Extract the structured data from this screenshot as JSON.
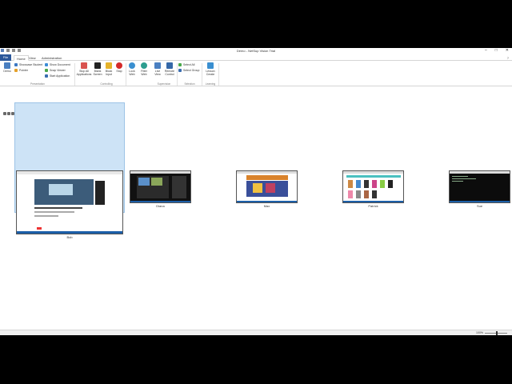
{
  "window": {
    "title": "Demo - NetSup Vision Trial"
  },
  "tabs": [
    "File",
    "Home",
    "View",
    "Administration"
  ],
  "ribbon": {
    "showcase_label": "Showcase Student",
    "pointer_label": "Pointer",
    "show_document_label": "Show Document",
    "snap_viewer_label": "Snap Viewer",
    "start_application_label": "Start Application",
    "demo_label": "Demo",
    "stop_all_label": "Stop All Applications",
    "blank_screen_label": "Blank Screen",
    "block_input_label": "Block Input",
    "stop_label": "Stop",
    "lock_web_label": "Lock Web",
    "filter_web_label": "Filter Web",
    "live_view_label": "Live View",
    "remote_control_label": "Remote Control",
    "select_all_label": "Select All",
    "select_group_label": "Select Group",
    "lesson_create_label": "Lesson Create",
    "groups": {
      "presentation": "Presentation",
      "controlling": "Controlling",
      "supervision": "Supervision",
      "selection": "Selection",
      "learning": "Learning"
    }
  },
  "students": [
    {
      "name": "Bob",
      "screen": "video"
    },
    {
      "name": "Diana",
      "screen": "social"
    },
    {
      "name": "Max",
      "screen": "game"
    },
    {
      "name": "Patrick",
      "screen": "store"
    },
    {
      "name": "Sue",
      "screen": "terminal"
    }
  ],
  "status": {
    "zoom": "100%"
  },
  "colors": {
    "file_tab": "#2b579a",
    "selection": "#cde3f6",
    "selection_border": "#9cc3e6"
  }
}
